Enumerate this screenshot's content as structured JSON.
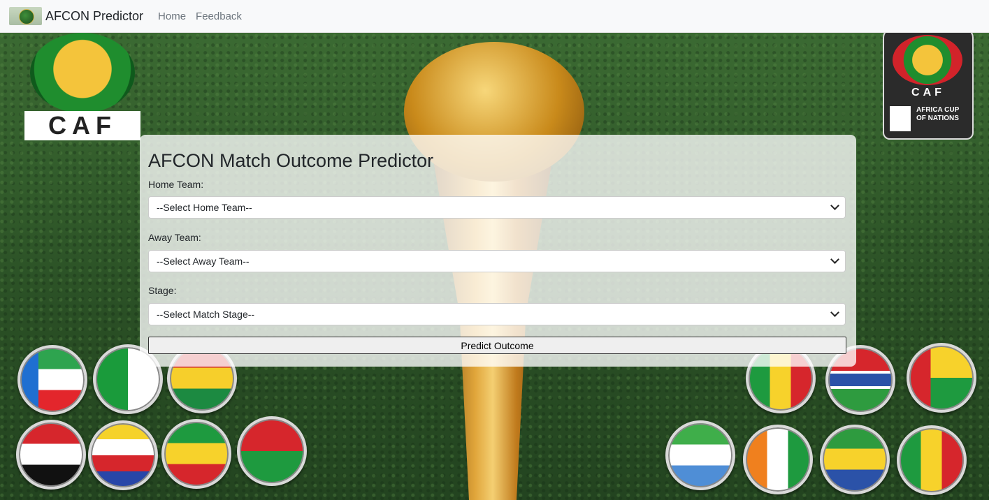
{
  "navbar": {
    "brand": "AFCON Predictor",
    "links": [
      "Home",
      "Feedback"
    ]
  },
  "logos": {
    "caf_left_text": "CAF",
    "caf_right_text": "CAF",
    "caf_right_tagline": "AFRICA CUP OF NATIONS"
  },
  "form": {
    "title": "AFCON Match Outcome Predictor",
    "home_label": "Home Team:",
    "home_selected": "--Select Home Team--",
    "away_label": "Away Team:",
    "away_selected": "--Select Away Team--",
    "stage_label": "Stage:",
    "stage_selected": "--Select Match Stage--",
    "predict_label": "Predict Outcome"
  },
  "flags": [
    "equatorial-guinea",
    "algeria",
    "ghana",
    "sudan",
    "comoros",
    "ethiopia",
    "burkina-faso",
    "mali",
    "gambia",
    "guinea-bissau",
    "sierra-leone",
    "ivory-coast",
    "gabon",
    "senegal"
  ]
}
